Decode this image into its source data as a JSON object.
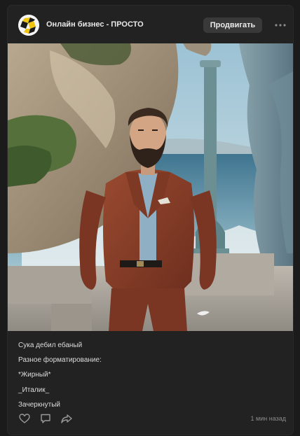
{
  "post": {
    "author": "Онлайн бизнес - ПРОСТО",
    "promote_label": "Продвигать",
    "more_icon": "more-horizontal-icon",
    "image_alt": "Мужчина в терракотовом костюме у моря",
    "caption_lines": [
      "Сука дебил ебаный",
      "Разное форматирование:",
      "*Жирный*",
      "_Италик_",
      "Зачеркнутый"
    ],
    "timestamp": "1 мин назад",
    "actions": {
      "like_icon": "heart-icon",
      "comment_icon": "comment-icon",
      "share_icon": "share-icon"
    }
  },
  "colors": {
    "background": "#1b1b1b",
    "card": "#222222",
    "button": "#393939",
    "text": "#e1e3e6",
    "muted": "#8a8a8a"
  }
}
